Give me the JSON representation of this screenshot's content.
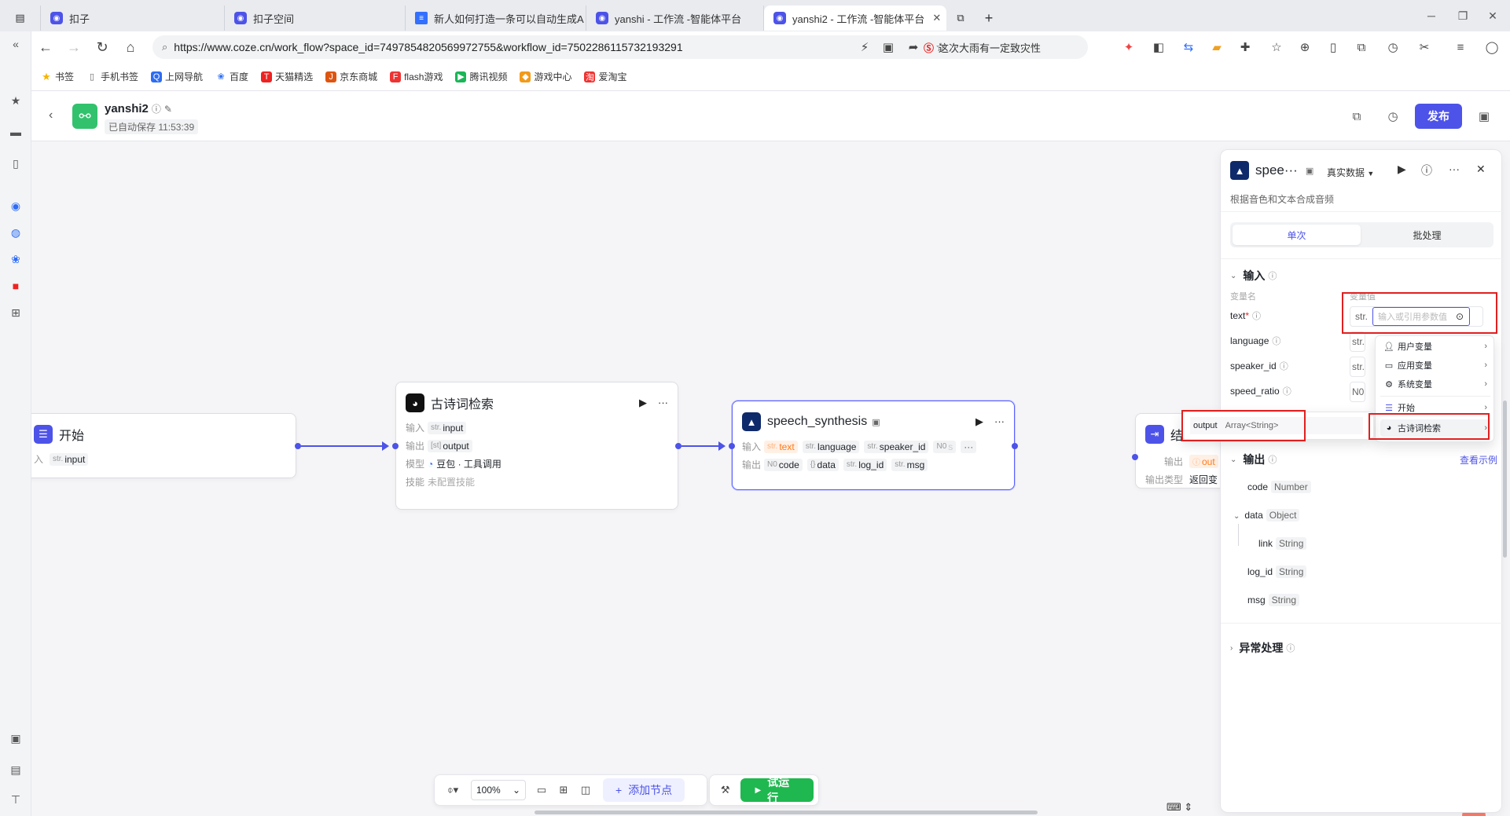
{
  "browser": {
    "tabs": [
      {
        "title": "扣子",
        "active": false
      },
      {
        "title": "扣子空间",
        "active": false
      },
      {
        "title": "新人如何打造一条可以自动生成A",
        "active": false
      },
      {
        "title": "yanshi - 工作流 -智能体平台",
        "active": false
      },
      {
        "title": "yanshi2 - 工作流 -智能体平台",
        "active": true
      }
    ],
    "url": "https://www.coze.cn/work_flow?space_id=7497854820569972755&workflow_id=7502286115732193291",
    "hot_news": "这次大雨有一定致灾性",
    "bookmarks": [
      "书签",
      "手机书签",
      "上网导航",
      "百度",
      "天猫精选",
      "京东商城",
      "flash游戏",
      "腾讯视频",
      "游戏中心",
      "爱淘宝"
    ]
  },
  "app": {
    "name": "yanshi2",
    "saved_text": "已自动保存 11:53:39",
    "publish_label": "发布"
  },
  "nodes": {
    "start": {
      "title": "开始",
      "input_label": "入",
      "input_param": "input",
      "input_type": "str."
    },
    "poetry": {
      "title": "古诗词检索",
      "input_label": "输入",
      "input_param": "input",
      "output_label": "输出",
      "output_param": "output",
      "model_label": "模型",
      "model_value": "豆包 · 工具调用",
      "skill_label": "技能",
      "skill_value": "未配置技能"
    },
    "speech": {
      "title": "speech_synthesis",
      "input_label": "输入",
      "inputs": [
        {
          "type": "str.",
          "name": "text",
          "warn": true
        },
        {
          "type": "str.",
          "name": "language",
          "warn": false
        },
        {
          "type": "str.",
          "name": "speaker_id",
          "warn": false
        },
        {
          "type": "N0",
          "name": "s",
          "warn": false
        }
      ],
      "output_label": "输出",
      "outputs": [
        {
          "type": "N0",
          "name": "code"
        },
        {
          "type": "{}",
          "name": "data"
        },
        {
          "type": "str.",
          "name": "log_id"
        },
        {
          "type": "str.",
          "name": "msg"
        }
      ]
    },
    "end": {
      "title": "结",
      "output_label": "输出",
      "output_param": "out",
      "output_type_label": "输出类型",
      "output_type_value": "返回变"
    }
  },
  "toolbar": {
    "zoom": "100%",
    "add_node": "添加节点",
    "run": "试运行"
  },
  "panel": {
    "title": "spee···",
    "data_mode": "真实数据",
    "description": "根据音色和文本合成音频",
    "tabs": [
      "单次",
      "批处理"
    ],
    "input_section": "输入",
    "col_name": "变量名",
    "col_value": "变量值",
    "fields": [
      {
        "name": "text",
        "required": "*",
        "type": "str.",
        "placeholder": "输入或引用参数值"
      },
      {
        "name": "language",
        "type": "str."
      },
      {
        "name": "speaker_id",
        "type": "str."
      },
      {
        "name": "speed_ratio",
        "type": "N0"
      }
    ],
    "output_section": "输出",
    "view_example": "查看示例",
    "outputs": [
      {
        "name": "code",
        "type": "Number"
      },
      {
        "name": "data",
        "type": "Object"
      },
      {
        "name": "link",
        "type": "String"
      },
      {
        "name": "log_id",
        "type": "String"
      },
      {
        "name": "msg",
        "type": "String"
      }
    ],
    "exception_section": "异常处理"
  },
  "dropdown": {
    "items": [
      "用户变量",
      "应用变量",
      "系统变量",
      "开始",
      "古诗词检索"
    ],
    "sub_item_name": "output",
    "sub_item_type": "Array<String>"
  }
}
